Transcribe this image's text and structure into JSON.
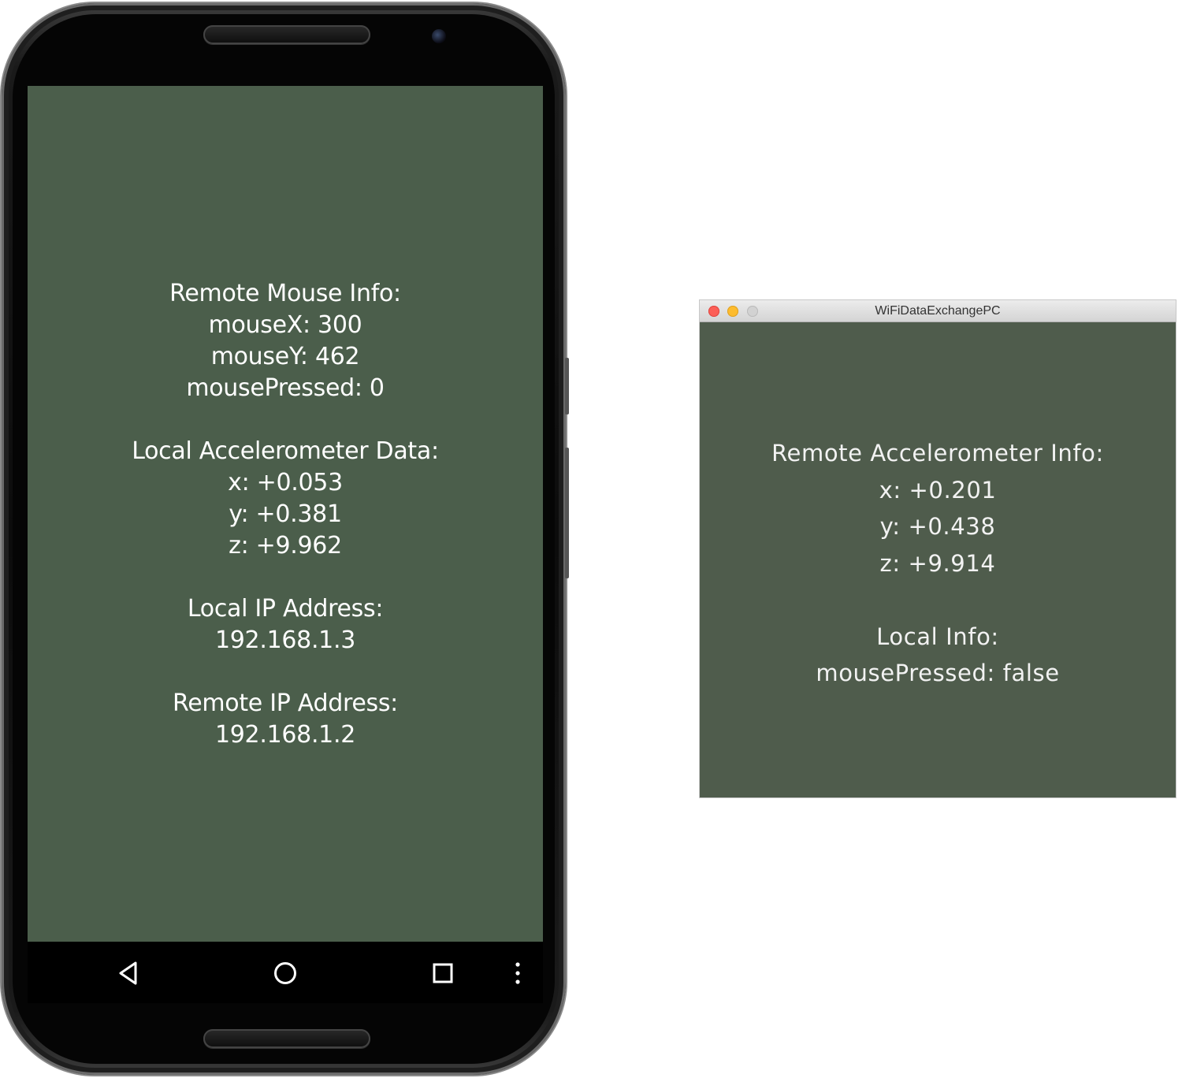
{
  "phone": {
    "remote_mouse": {
      "heading": "Remote Mouse Info:",
      "mouse_x": "mouseX: 300",
      "mouse_y": "mouseY: 462",
      "mouse_pressed": "mousePressed: 0"
    },
    "local_accel": {
      "heading": "Local Accelerometer Data:",
      "x": "x: +0.053",
      "y": "y: +0.381",
      "z": "z: +9.962"
    },
    "local_ip": {
      "heading": "Local IP Address:",
      "value": "192.168.1.3"
    },
    "remote_ip": {
      "heading": "Remote IP Address:",
      "value": "192.168.1.2"
    },
    "navbar": {
      "back_icon": "back-triangle-icon",
      "home_icon": "home-circle-icon",
      "recents_icon": "recents-square-icon",
      "menu_icon": "overflow-menu-icon"
    },
    "colors": {
      "screen_bg": "#4b5e4b",
      "text": "#ffffff"
    }
  },
  "window": {
    "title": "WiFiDataExchangePC",
    "remote_accel": {
      "heading": "Remote Accelerometer Info:",
      "x": "x: +0.201",
      "y": "y: +0.438",
      "z": "z: +9.914"
    },
    "local_info": {
      "heading": "Local Info:",
      "mouse_pressed": "mousePressed: false"
    },
    "colors": {
      "bg": "#4f5c4c",
      "close": "#fc5f57",
      "minimize": "#fdbc2e",
      "maximize": "#d2d2d2"
    }
  }
}
